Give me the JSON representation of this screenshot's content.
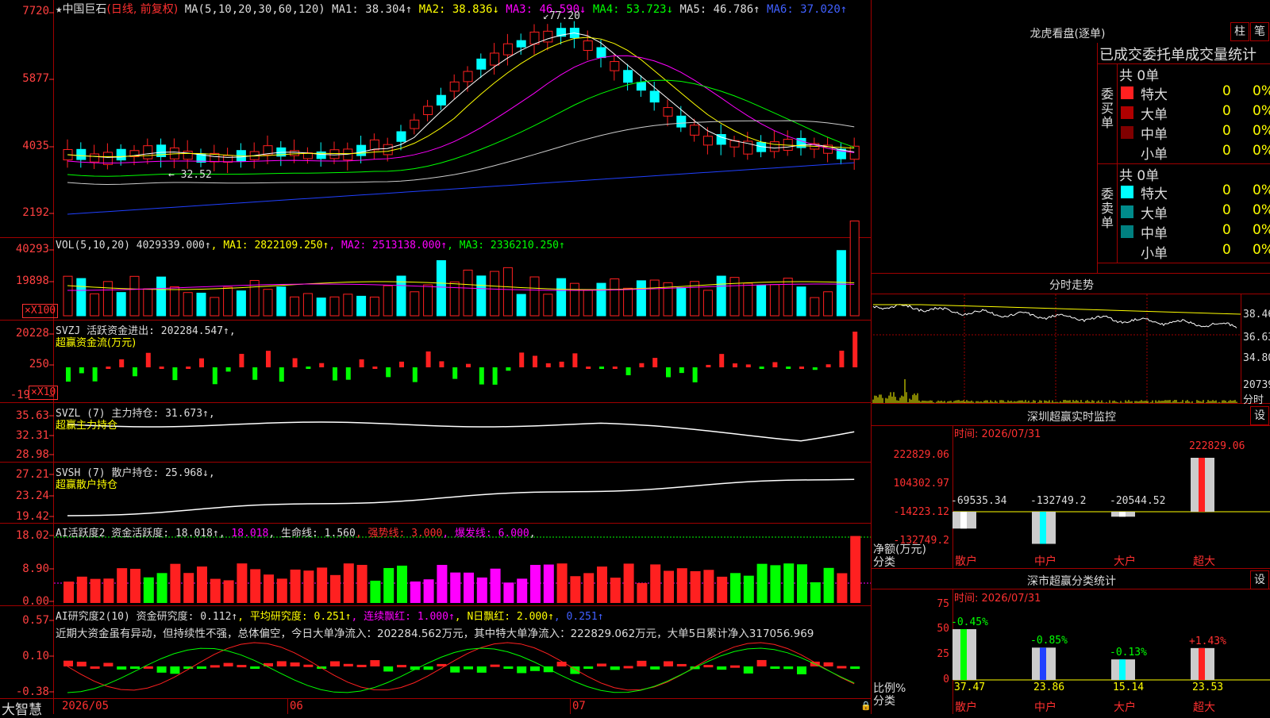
{
  "stock": {
    "star": "★",
    "name": "中国巨石",
    "period": "(日线, 前复权)"
  },
  "ma_line": [
    {
      "t": "MA(5,10,20,30,60,120)",
      "c": "#ddd"
    },
    {
      "t": " MA1: 38.304↑",
      "c": "#ddd"
    },
    {
      "t": " MA2: 38.836↓",
      "c": "#ffff00"
    },
    {
      "t": " MA3: 46.590↓",
      "c": "#ff00ff"
    },
    {
      "t": " MA4: 53.723↓",
      "c": "#00ff00"
    },
    {
      "t": " MA5: 46.786↑",
      "c": "#dddddd"
    },
    {
      "t": " MA6: 37.020↑",
      "c": "#4060ff"
    }
  ],
  "price_axis": [
    "7720",
    "5877",
    "4035",
    "2192"
  ],
  "price_annotations": {
    "high": "77.20",
    "low": "32.52"
  },
  "vol_line": [
    {
      "t": "VOL(5,10,20)",
      "c": "#ddd"
    },
    {
      "t": " 4029339.000↑",
      "c": "#ddd"
    },
    {
      "t": ", MA1: 2822109.250↑",
      "c": "#ffff00"
    },
    {
      "t": ", MA2: 2513138.000↑",
      "c": "#ff00ff"
    },
    {
      "t": ", MA3: 2336210.250↑",
      "c": "#00ff00"
    }
  ],
  "vol_axis": [
    "40293",
    "19898"
  ],
  "vol_unit": "X100",
  "svzj": {
    "line1": "SVZJ  活跃资金进出: 202284.547↑,",
    "line2": "超赢资金流(万元)",
    "axis": [
      "20228",
      "250",
      "-19"
    ],
    "unit": "X10"
  },
  "svzl": {
    "line1": "SVZL (7) 主力持仓: 31.673↑,",
    "line2": "超赢主力持仓",
    "axis": [
      "35.63",
      "32.31",
      "28.98"
    ]
  },
  "svsh": {
    "line1": "SVSH (7) 散户持仓: 25.968↓,",
    "line2": "超赢散户持仓",
    "axis": [
      "27.21",
      "23.24",
      "19.42"
    ]
  },
  "ai1": {
    "parts": [
      {
        "t": "AI活跃度2 资金活跃度: 18.018↑,",
        "c": "#ddd"
      },
      {
        "t": " 18.018",
        "c": "#ff00ff"
      },
      {
        "t": ", 生命线: 1.560",
        "c": "#ddd"
      },
      {
        "t": ", 强势线: 3.000",
        "c": "#ff3030"
      },
      {
        "t": ", 爆发线: 6.000",
        "c": "#ff00ff"
      },
      {
        "t": ",",
        "c": "#ddd"
      }
    ],
    "axis": [
      "18.02",
      "8.90",
      "0.00"
    ]
  },
  "ai2": {
    "parts": [
      {
        "t": "AI研究度2(10) 资金研究度: 0.112↑",
        "c": "#ddd"
      },
      {
        "t": ", 平均研究度: 0.251↑",
        "c": "#ffff00"
      },
      {
        "t": ", 连续飘红: 1.000↑",
        "c": "#ff00ff"
      },
      {
        "t": ", N日飘红: 2.000↑",
        "c": "#ffff00"
      },
      {
        "t": ", 0.251↑",
        "c": "#4060ff"
      }
    ],
    "comment": "近期大资金虽有异动，但持续性不强，总体偏空，今日大单净流入：202284.562万元，其中特大单净流入：222829.062万元，大单5日累计净入317056.969",
    "axis": [
      "0.57",
      "0.10",
      "-0.38"
    ]
  },
  "date_axis": {
    "brand": "大智慧",
    "ticks": [
      "2026/05",
      "06",
      "07"
    ]
  },
  "lhb": {
    "title": "龙虎看盘(逐单)",
    "btn1": "柱",
    "btn2": "笔",
    "header": "已成交委托单成交量统计",
    "buy": {
      "vlabel": "委买单",
      "total": "共 0单",
      "rows": [
        {
          "label": "特大",
          "val": "0",
          "pct": "0%",
          "color": "#ff2020"
        },
        {
          "label": "大单",
          "val": "0",
          "pct": "0%",
          "color": "#b00000"
        },
        {
          "label": "中单",
          "val": "0",
          "pct": "0%",
          "color": "#800000"
        },
        {
          "label": "小单",
          "val": "0",
          "pct": "0%",
          "color": ""
        }
      ]
    },
    "sell": {
      "vlabel": "委卖单",
      "total": "共 0单",
      "rows": [
        {
          "label": "特大",
          "val": "0",
          "pct": "0%",
          "color": "#00ffff"
        },
        {
          "label": "大单",
          "val": "0",
          "pct": "0%",
          "color": "#008b8b"
        },
        {
          "label": "中单",
          "val": "0",
          "pct": "0%",
          "color": "#008080"
        },
        {
          "label": "小单",
          "val": "0",
          "pct": "0%",
          "color": ""
        }
      ]
    }
  },
  "intraday": {
    "title": "分时走势",
    "axis": [
      "38.46",
      "36.63",
      "34.80"
    ],
    "vol_axis": "20739",
    "unit": "分时"
  },
  "sz_monitor": {
    "title": "深圳超赢实时监控",
    "btn": "设",
    "time": "时间: 2026/07/31",
    "axis": [
      "222829.06",
      "104302.97",
      "-14223.12",
      "-132749.2"
    ],
    "ylabel": "净额(万元)",
    "xlabel": "分类",
    "categories": [
      "散户",
      "中户",
      "大户",
      "超大"
    ],
    "values": [
      -69535.34,
      -132749.2,
      -20544.52,
      222829.06
    ],
    "value_labels": [
      "-69535.34",
      "-132749.2",
      "-20544.52",
      "222829.06"
    ]
  },
  "sz_class": {
    "title": "深市超赢分类统计",
    "btn": "设",
    "time": "时间: 2026/07/31",
    "axis": [
      "75",
      "50",
      "25",
      "0"
    ],
    "ylabel": "比例%",
    "xlabel": "分类",
    "categories": [
      "散户",
      "中户",
      "大户",
      "超大"
    ],
    "values": [
      37.47,
      23.86,
      15.14,
      23.53
    ],
    "value_labels": [
      "37.47",
      "23.86",
      "15.14",
      "23.53"
    ],
    "changes": [
      "-0.45%",
      "-0.85%",
      "-0.13%",
      "+1.43%"
    ]
  },
  "colors": {
    "up": "#ff2020",
    "down": "#00ffff",
    "grid": "#a00000"
  }
}
